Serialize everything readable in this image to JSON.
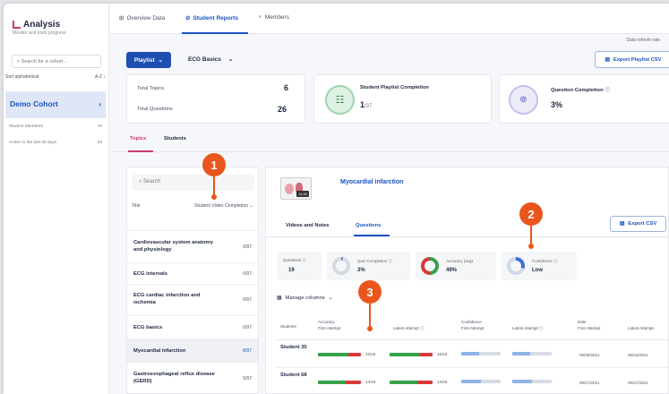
{
  "sidebar": {
    "brand": "Analysis",
    "subtitle": "Monitor and track progress",
    "search_placeholder": "Search for a cohort...",
    "sort_label": "Sort alphabetical",
    "sort_value": "A-Z ↕",
    "cohort_name": "Demo Cohort",
    "rows": [
      {
        "label": "Student Members",
        "value": "76"
      },
      {
        "label": "Active in the last 30 days",
        "value": "33"
      }
    ]
  },
  "topnav": {
    "tabs": [
      "Overview Data",
      "Student Reports",
      "Members"
    ],
    "active_tab": "Student Reports"
  },
  "refresh_note": "Data refresh rate",
  "toolbar": {
    "playlist_button": "Playlist",
    "playlist_select": "ECG Basics",
    "export_playlist": "Export Playlist CSV"
  },
  "summary": {
    "total_topics_label": "Total Topics",
    "total_topics": "6",
    "total_questions_label": "Total Questions",
    "total_questions": "26",
    "playlist_completion_label": "Student Playlist Completion",
    "playlist_completion_num": "1",
    "playlist_completion_den": "/97",
    "question_completion_label": "Question Completion",
    "question_completion": "3%"
  },
  "page_tabs": [
    "Topics",
    "Students"
  ],
  "topics_panel": {
    "search_placeholder": "Search",
    "col_title": "Title",
    "col_sort": "Student Video Completion",
    "items": [
      {
        "name": "Cardiovascular system anatomy and physiology",
        "value": "0/97"
      },
      {
        "name": "ECG intervals",
        "value": "0/97"
      },
      {
        "name": "ECG cardiac infarction and ischemia",
        "value": "0/97"
      },
      {
        "name": "ECG basics",
        "value": "0/97"
      },
      {
        "name": "Myocardial infarction",
        "value": "8/97",
        "selected": true
      },
      {
        "name": "Gastroesophageal reflux disease (GERD)",
        "value": "5/97"
      }
    ]
  },
  "detail": {
    "title": "Myocardial infarction",
    "thumb_time": "11:40",
    "tabs": [
      "Videos and Notes",
      "Questions"
    ],
    "export_csv": "Export CSV",
    "metrics": [
      {
        "label": "Questions",
        "value": "19"
      },
      {
        "label": "Quiz Completion",
        "value": "3%"
      },
      {
        "label": "Accuracy (avg)",
        "value": "49%"
      },
      {
        "label": "Confidence",
        "value": "Low"
      }
    ],
    "manage_columns": "Manage columns",
    "table_headers": {
      "students": "Students",
      "accuracy": "Accuracy",
      "first_attempt": "First Attempt",
      "latest_attempt": "Latest Attempt",
      "confidence": "Confidence",
      "conf_first": "First Attempt",
      "conf_latest": "Latest Attempt",
      "date": "Date",
      "date_first": "First Attempt",
      "date_latest": "Latest Attempt"
    },
    "rows": [
      {
        "name": "Student 35",
        "first": "15/19",
        "latest": "15/19",
        "date_first": "05/06/2021",
        "date_latest": "06/22/2021"
      },
      {
        "name": "Student 68",
        "first": "14/19",
        "latest": "14/19",
        "date_first": "06/27/2021",
        "date_latest": "06/27/2021"
      }
    ]
  },
  "callouts": [
    "1",
    "2",
    "3"
  ],
  "colors": {
    "accent": "#1a53c3",
    "brand": "#c93b6d",
    "callout": "#e8561d",
    "correct": "#35a04a",
    "wrong": "#d9383a",
    "confidence": "#8eb4e6"
  }
}
